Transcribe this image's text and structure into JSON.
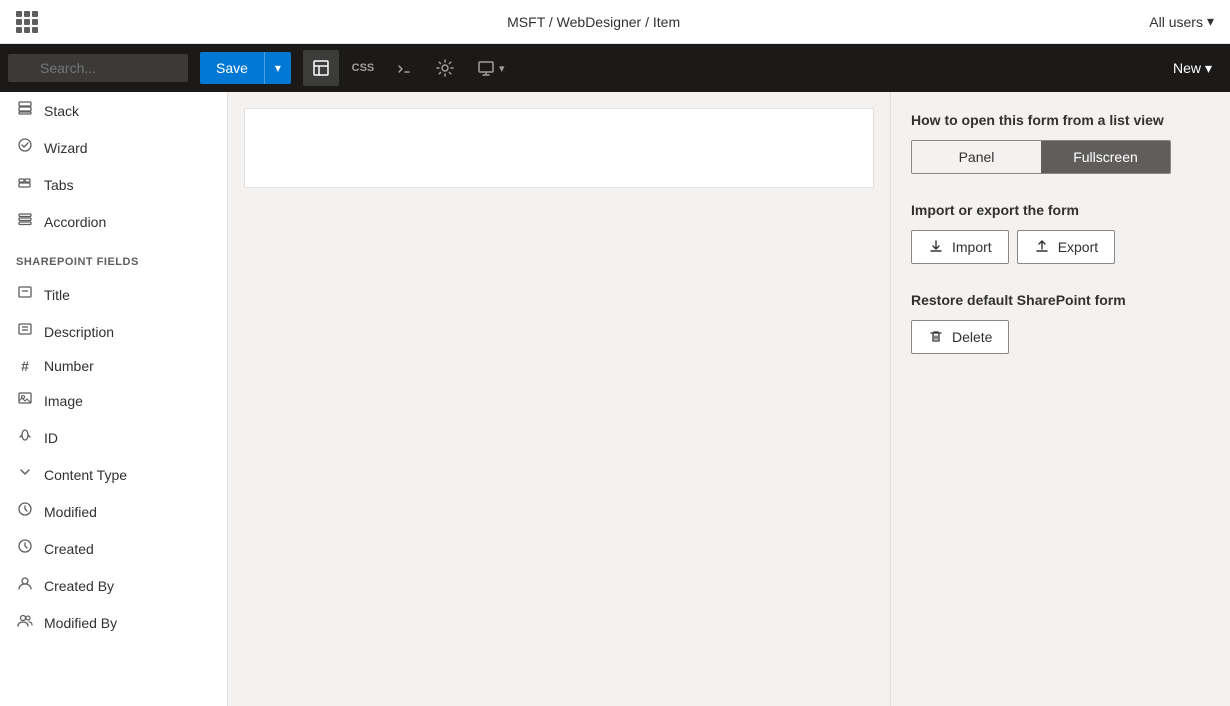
{
  "topbar": {
    "breadcrumb": "MSFT / WebDesigner / Item",
    "allusers_label": "All users",
    "chevron_down": "▾"
  },
  "toolbar": {
    "search_placeholder": "Search...",
    "save_label": "Save",
    "new_label": "New",
    "chevron": "▾"
  },
  "sidebar": {
    "components_section": null,
    "items": [
      {
        "id": "stack",
        "label": "Stack",
        "icon": "▤"
      },
      {
        "id": "wizard",
        "label": "Wizard",
        "icon": "✦"
      },
      {
        "id": "tabs",
        "label": "Tabs",
        "icon": "⊟"
      },
      {
        "id": "accordion",
        "label": "Accordion",
        "icon": "☰"
      }
    ],
    "fields_section": "SHAREPOINT FIELDS",
    "fields": [
      {
        "id": "title",
        "label": "Title",
        "icon": "☐"
      },
      {
        "id": "description",
        "label": "Description",
        "icon": "☐"
      },
      {
        "id": "number",
        "label": "Number",
        "icon": "#"
      },
      {
        "id": "image",
        "label": "Image",
        "icon": "⬜"
      },
      {
        "id": "id",
        "label": "ID",
        "icon": "🔑"
      },
      {
        "id": "content-type",
        "label": "Content Type",
        "icon": "▽"
      },
      {
        "id": "modified",
        "label": "Modified",
        "icon": "⏱"
      },
      {
        "id": "created",
        "label": "Created",
        "icon": "⏱"
      },
      {
        "id": "created-by",
        "label": "Created By",
        "icon": "👤"
      },
      {
        "id": "modified-by",
        "label": "Modified By",
        "icon": "👥"
      }
    ]
  },
  "rightpanel": {
    "open_form_title": "How to open this form from a list view",
    "panel_label": "Panel",
    "fullscreen_label": "Fullscreen",
    "import_export_title": "Import or export the form",
    "import_label": "Import",
    "export_label": "Export",
    "restore_title": "Restore default SharePoint form",
    "delete_label": "Delete"
  },
  "icons": {
    "grid": "⊞",
    "search": "🔍",
    "no_code": "⊘",
    "css": "CSS",
    "js": "JS",
    "settings": "⚙",
    "preview": "🖥",
    "upload": "⬆",
    "download": "⬇",
    "trash": "🗑"
  }
}
